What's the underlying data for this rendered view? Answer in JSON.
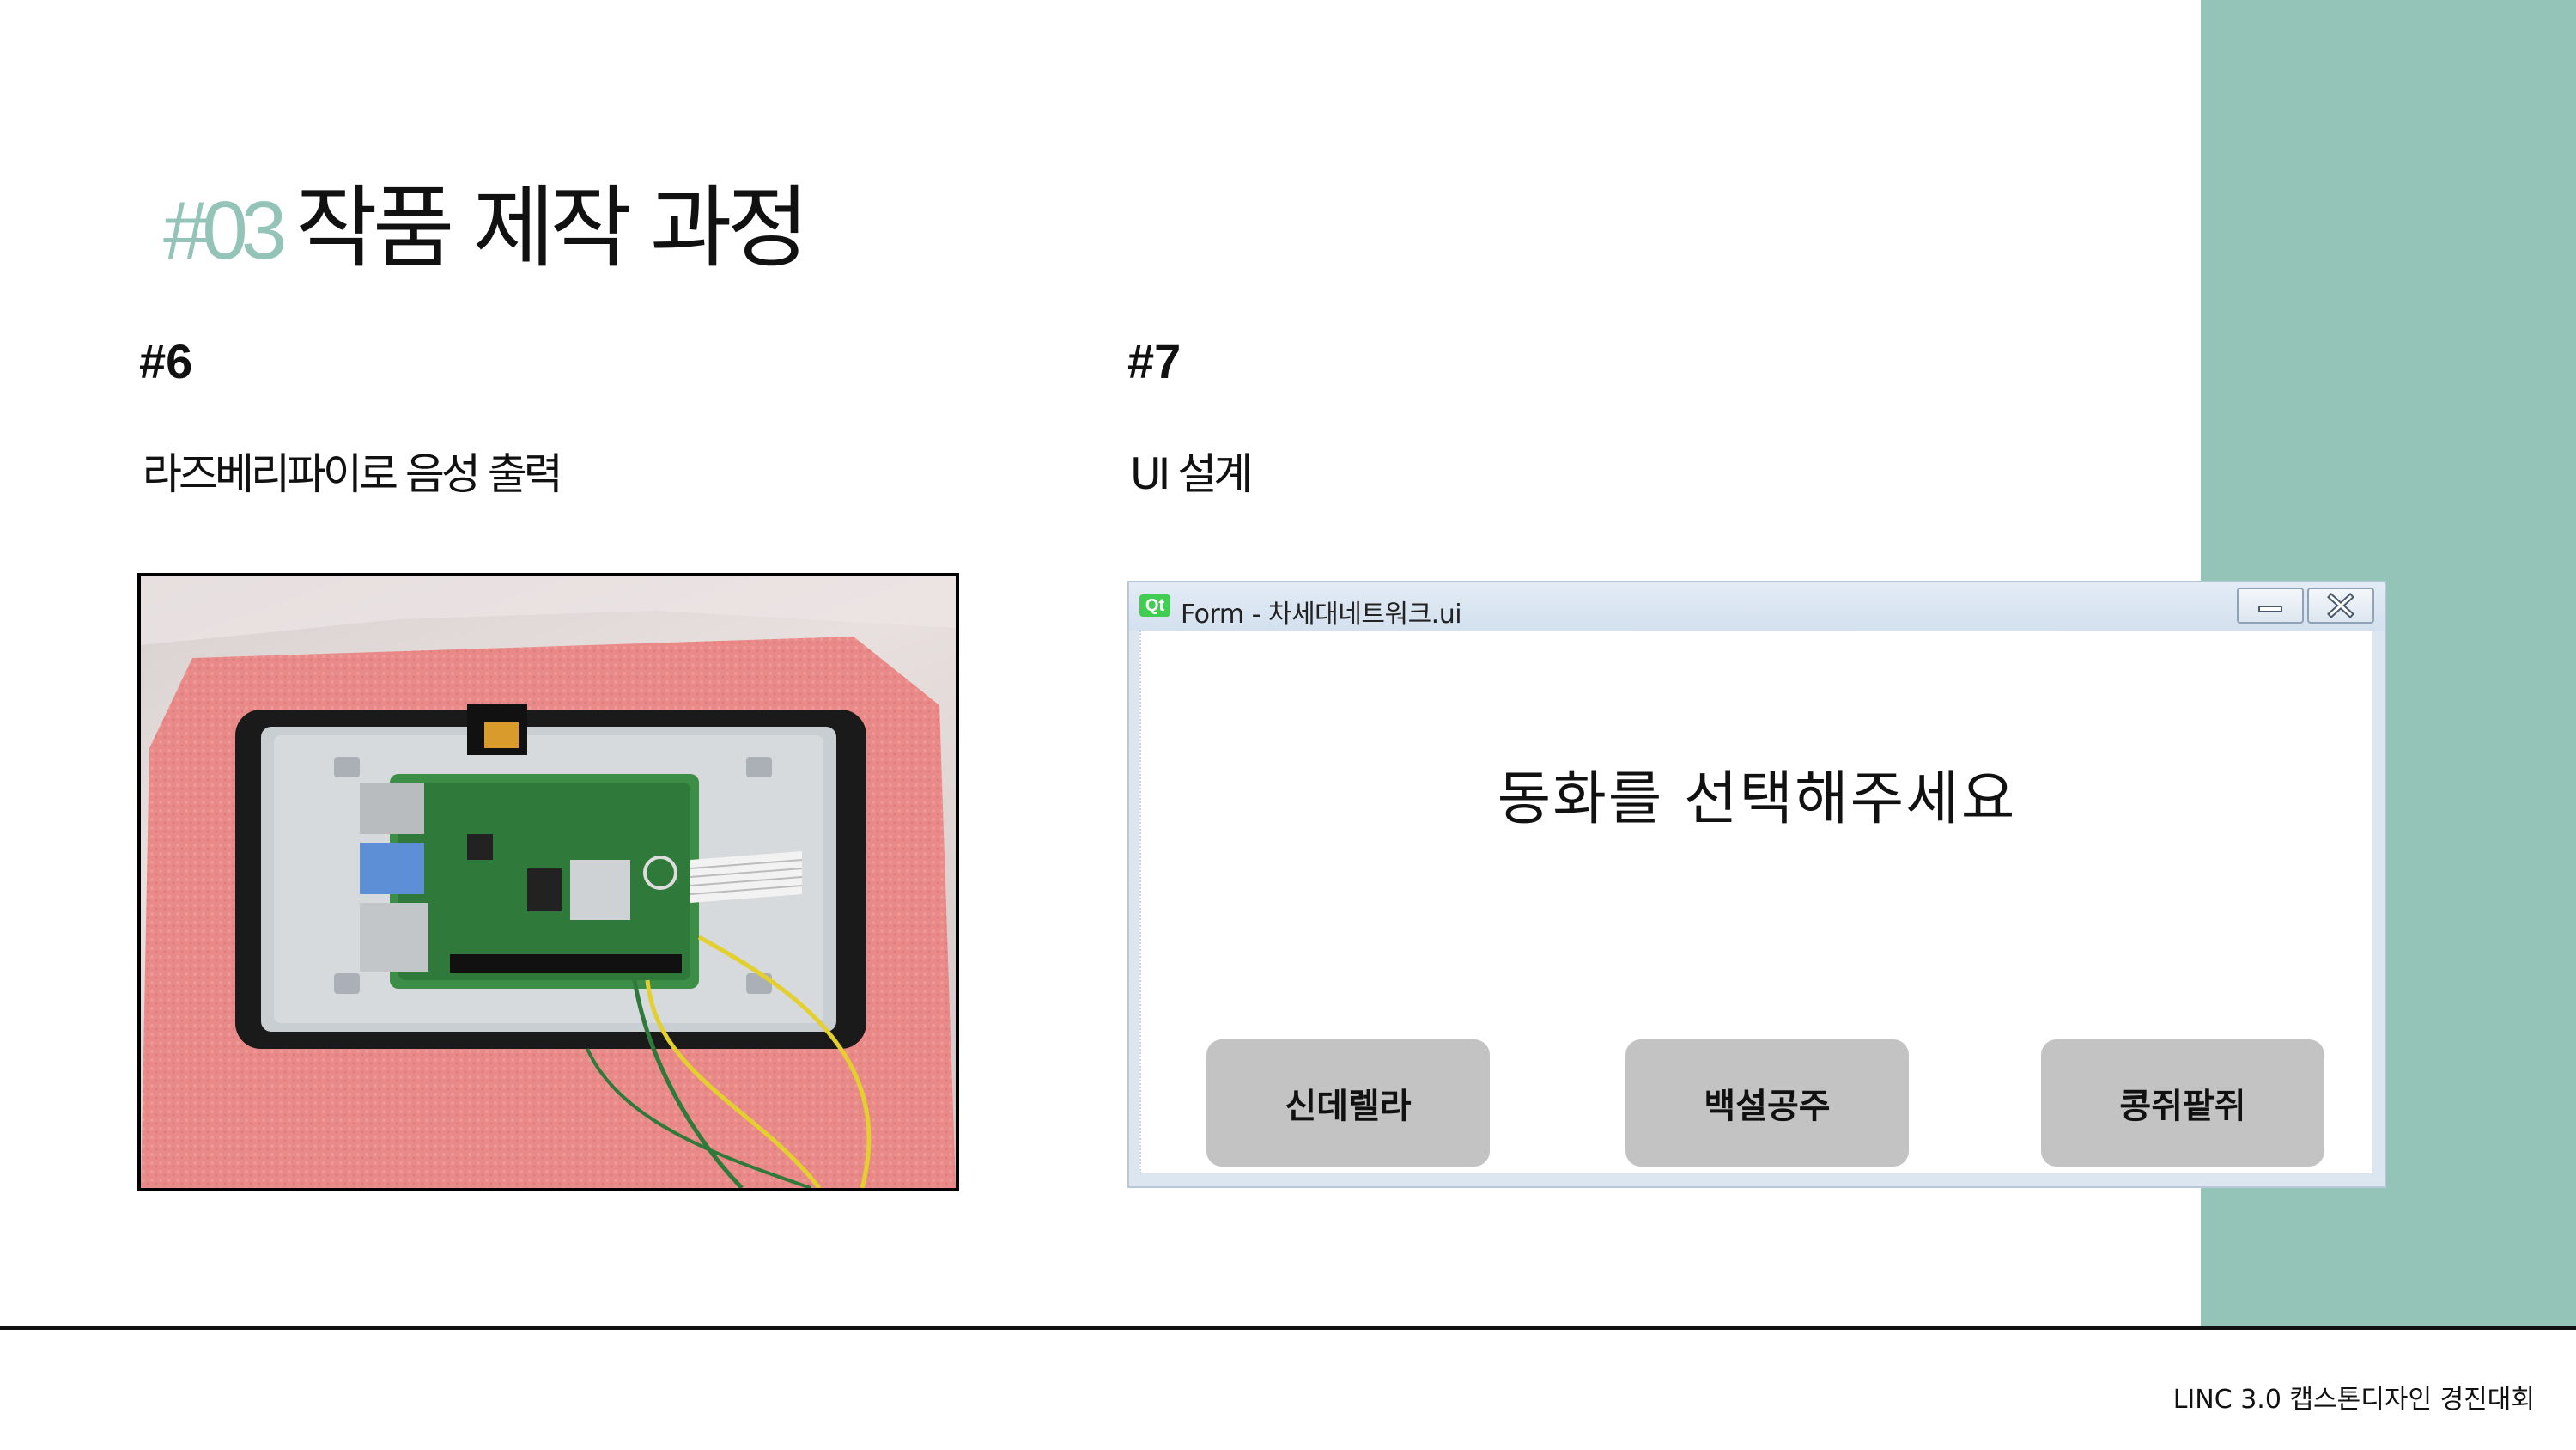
{
  "accent_color": "#93c4b7",
  "title": {
    "number": "#03",
    "text": "작품 제작 과정"
  },
  "left_section": {
    "number": "#6",
    "subtitle": "라즈베리파이로 음성 출력",
    "image": "raspberry-pi-with-touchscreen-photo"
  },
  "right_section": {
    "number": "#7",
    "subtitle": "UI 설계",
    "qt_window": {
      "logo": "Qt",
      "title": "Form - 차세대네트워크.ui",
      "heading": "동화를 선택해주세요",
      "buttons": [
        {
          "label": "신데렐라"
        },
        {
          "label": "백설공주"
        },
        {
          "label": "콩쥐팥쥐"
        }
      ]
    }
  },
  "footer": "LINC 3.0 캡스톤디자인 경진대회"
}
